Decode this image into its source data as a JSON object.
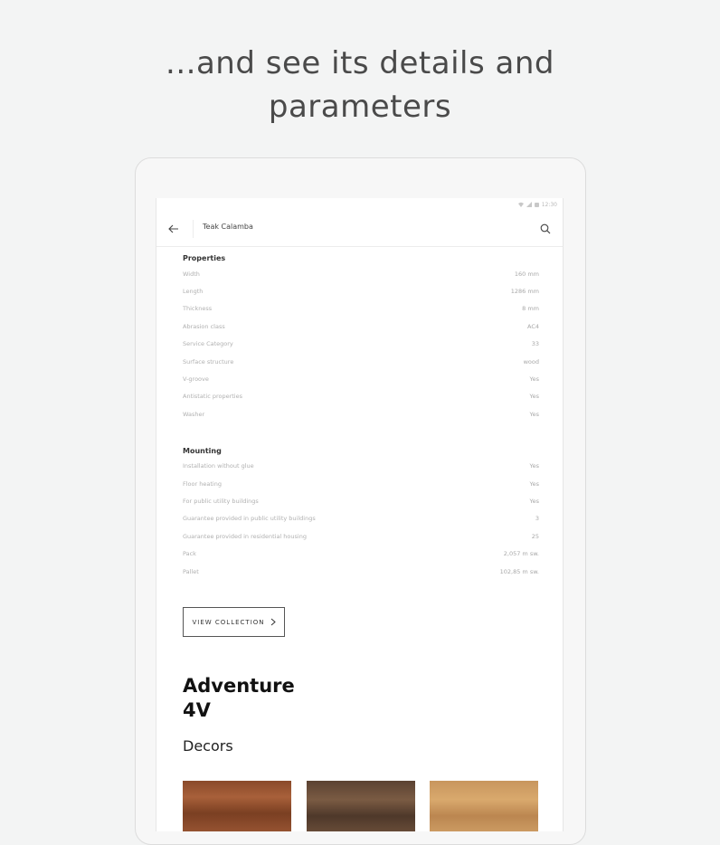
{
  "headline": {
    "line1": "...and see its details and",
    "line2": "parameters"
  },
  "status_bar": {
    "time": "12:30"
  },
  "app_bar": {
    "title": "Teak Calamba"
  },
  "properties": {
    "title": "Properties",
    "rows": [
      {
        "label": "Width",
        "value": "160 mm"
      },
      {
        "label": "Length",
        "value": "1286 mm"
      },
      {
        "label": "Thickness",
        "value": "8 mm"
      },
      {
        "label": "Abrasion class",
        "value": "AC4"
      },
      {
        "label": "Service Category",
        "value": "33"
      },
      {
        "label": "Surface structure",
        "value": "wood"
      },
      {
        "label": "V-groove",
        "value": "Yes"
      },
      {
        "label": "Antistatic properties",
        "value": "Yes"
      },
      {
        "label": "Washer",
        "value": "Yes"
      }
    ]
  },
  "mounting": {
    "title": "Mounting",
    "rows": [
      {
        "label": "Installation without glue",
        "value": "Yes"
      },
      {
        "label": "Floor heating",
        "value": "Yes"
      },
      {
        "label": "For public utility buildings",
        "value": "Yes"
      },
      {
        "label": "Guarantee provided in public utility buildings",
        "value": "3"
      },
      {
        "label": "Guarantee provided in residential housing",
        "value": "25"
      },
      {
        "label": "Pack",
        "value": "2,057 m sw."
      },
      {
        "label": "Pallet",
        "value": "102,85 m sw."
      }
    ]
  },
  "view_collection": {
    "label": "VIEW COLLECTION"
  },
  "collection": {
    "line1": "Adventure",
    "line2": "4V"
  },
  "decors": {
    "title": "Decors"
  },
  "icons": [
    "back-arrow-icon",
    "search-icon",
    "chevron-right-icon",
    "wifi-icon",
    "signal-icon",
    "battery-icon"
  ]
}
